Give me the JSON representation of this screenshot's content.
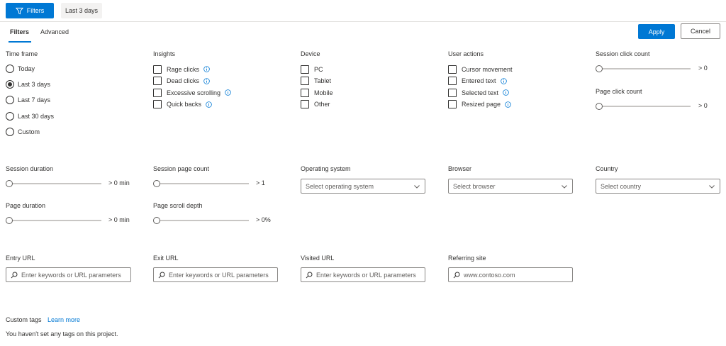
{
  "toolbar": {
    "filters_label": "Filters",
    "range_chip": "Last 3 days"
  },
  "tabs": [
    {
      "label": "Filters",
      "active": true
    },
    {
      "label": "Advanced",
      "active": false
    }
  ],
  "actions": {
    "apply": "Apply",
    "cancel": "Cancel"
  },
  "time_frame": {
    "title": "Time frame",
    "options": [
      "Today",
      "Last 3 days",
      "Last 7 days",
      "Last 30 days",
      "Custom"
    ],
    "selected": "Last 3 days"
  },
  "insights": {
    "title": "Insights",
    "items": [
      "Rage clicks",
      "Dead clicks",
      "Excessive scrolling",
      "Quick backs"
    ]
  },
  "device": {
    "title": "Device",
    "items": [
      "PC",
      "Tablet",
      "Mobile",
      "Other"
    ]
  },
  "user_actions": {
    "title": "User actions",
    "items": [
      "Cursor movement",
      "Entered text",
      "Selected text",
      "Resized page"
    ]
  },
  "sliders": {
    "session_click_count": {
      "label": "Session click count",
      "value": "> 0"
    },
    "page_click_count": {
      "label": "Page click count",
      "value": "> 0"
    },
    "session_duration": {
      "label": "Session duration",
      "value": "> 0 min"
    },
    "session_page_count": {
      "label": "Session page count",
      "value": "> 1"
    },
    "page_duration": {
      "label": "Page duration",
      "value": "> 0 min"
    },
    "page_scroll_depth": {
      "label": "Page scroll depth",
      "value": "> 0%"
    }
  },
  "dropdowns": {
    "operating_system": {
      "label": "Operating system",
      "placeholder": "Select operating system"
    },
    "browser": {
      "label": "Browser",
      "placeholder": "Select browser"
    },
    "country": {
      "label": "Country",
      "placeholder": "Select country"
    }
  },
  "urls": {
    "entry": {
      "label": "Entry URL",
      "placeholder": "Enter keywords or URL parameters"
    },
    "exit": {
      "label": "Exit URL",
      "placeholder": "Enter keywords or URL parameters"
    },
    "visited": {
      "label": "Visited URL",
      "placeholder": "Enter keywords or URL parameters"
    },
    "referring": {
      "label": "Referring site",
      "placeholder": "www.contoso.com"
    }
  },
  "custom_tags": {
    "title": "Custom tags",
    "learn_more": "Learn more",
    "empty_message": "You haven't set any tags on this project."
  },
  "colors": {
    "accent": "#0078d4",
    "text": "#323130",
    "border": "#8a8886"
  },
  "icons": {
    "filter": "filter-icon",
    "info": "info-icon",
    "search": "search-icon",
    "chevron": "chevron-down-icon"
  }
}
